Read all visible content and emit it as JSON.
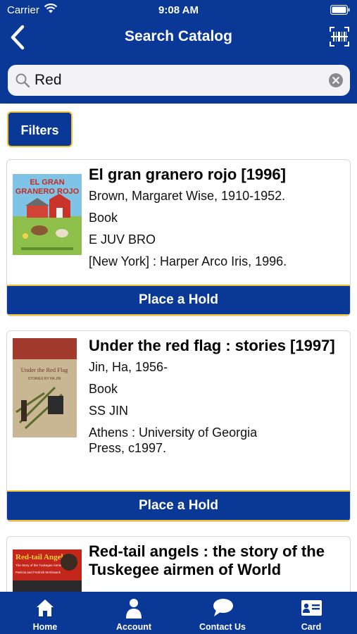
{
  "status_bar": {
    "carrier": "Carrier",
    "time": "9:08 AM"
  },
  "nav": {
    "title": "Search Catalog",
    "back_icon": "chevron-left-icon",
    "scan_icon": "barcode-scan-icon"
  },
  "search": {
    "value": "Red",
    "icon": "search-icon",
    "clear_icon": "clear-icon"
  },
  "filters_label": "Filters",
  "results": [
    {
      "title": "El gran granero rojo [1996]",
      "lines": [
        "Brown, Margaret Wise, 1910-1952.",
        "Book",
        "E JUV BRO",
        "[New York] : Harper Arco Iris, 1996."
      ],
      "cover_text": [
        "EL GRAN",
        "GRANERO ROJO"
      ],
      "hold_label": "Place a Hold"
    },
    {
      "title": "Under the red flag : stories [1997]",
      "lines": [
        "Jin, Ha, 1956-",
        "Book",
        "SS JIN",
        "Athens : University of Georgia Press, c1997."
      ],
      "cover_text": [
        "Under the Red Flag",
        "STORIES BY HA JIN"
      ],
      "hold_label": "Place a Hold"
    },
    {
      "title": "Red-tail angels : the story of the Tuskegee airmen of World",
      "lines": [],
      "cover_text": [
        "Red-tail Angels",
        "The Story of the Tuskegee Airmen",
        "Patricia and Fredrick McKissack"
      ],
      "hold_label": ""
    }
  ],
  "tabbar": [
    {
      "label": "Home",
      "icon": "home-icon"
    },
    {
      "label": "Account",
      "icon": "account-icon"
    },
    {
      "label": "Contact Us",
      "icon": "chat-icon"
    },
    {
      "label": "Card",
      "icon": "card-icon"
    }
  ],
  "colors": {
    "primary": "#0a3896",
    "accent": "#f1c232",
    "background": "#ffffff"
  }
}
